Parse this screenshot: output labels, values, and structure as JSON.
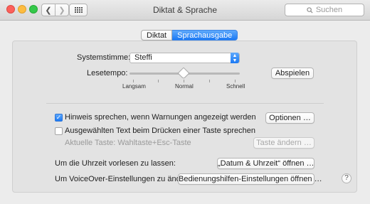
{
  "window": {
    "title": "Diktat & Sprache",
    "search_placeholder": "Suchen"
  },
  "tabs": [
    {
      "label": "Diktat",
      "active": false
    },
    {
      "label": "Sprachausgabe",
      "active": true
    }
  ],
  "speech": {
    "system_voice_label": "Systemstimme:",
    "system_voice_value": "Steffi",
    "rate_label": "Lesetempo:",
    "rate_ticks": {
      "slow": "Langsam",
      "normal": "Normal",
      "fast": "Schnell"
    },
    "rate_value": "Normal",
    "play_button": "Abspielen"
  },
  "alerts": {
    "announce_label": "Hinweis sprechen, wenn Warnungen angezeigt werden",
    "announce_checked": true,
    "options_button": "Optionen …",
    "speak_selected_label": "Ausgewählten Text beim Drücken einer Taste sprechen",
    "speak_selected_checked": false,
    "current_key_label": "Aktuelle Taste: Wahltaste+Esc-Taste",
    "change_key_button": "Taste ändern …"
  },
  "clock": {
    "label": "Um die Uhrzeit vorlesen zu lassen:",
    "button": "„Datum & Uhrzeit“ öffnen …"
  },
  "voiceover": {
    "label": "Um VoiceOver-Einstellungen zu ändern:",
    "button": "Bedienungshilfen-Einstellungen öffnen …"
  },
  "help": "?",
  "colors": {
    "accent": "#1b79f4",
    "window_bg": "#ececec",
    "panel_bg": "#e3e3e3"
  }
}
